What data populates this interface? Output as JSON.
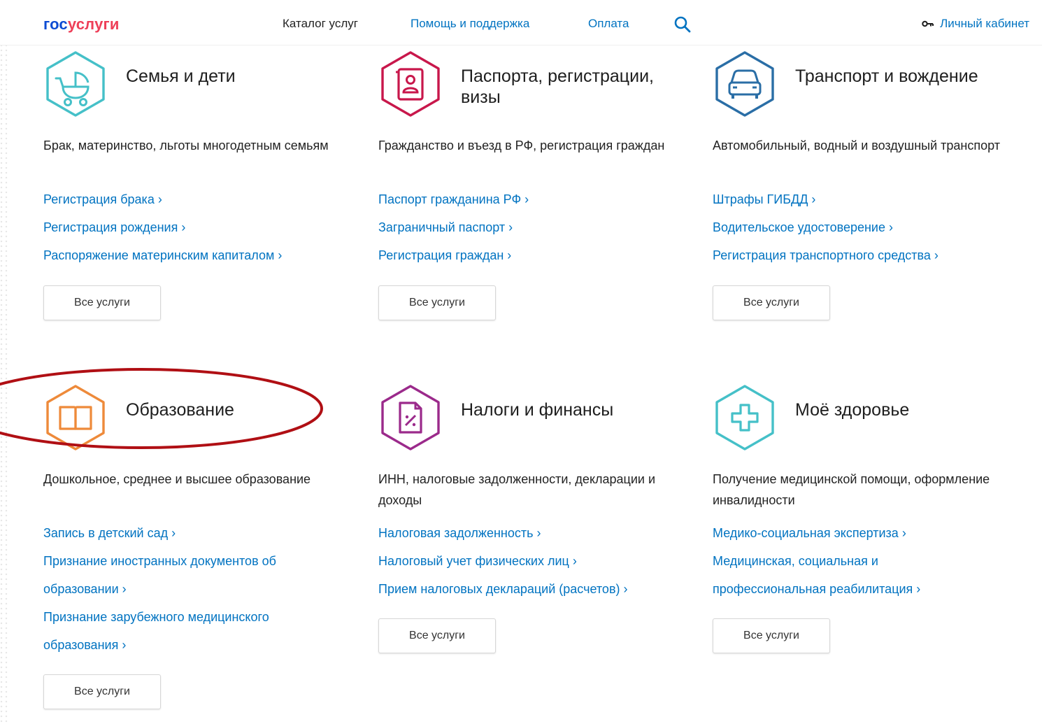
{
  "header": {
    "logo_part1": "гос",
    "logo_part2": "услуги",
    "nav": [
      "Каталог услуг",
      "Помощь и поддержка",
      "Оплата"
    ],
    "search_icon": "search-icon",
    "account_label": "Личный кабинет",
    "account_icon": "key-icon"
  },
  "colors": {
    "link": "#0173c1",
    "family": "#45c0c8",
    "passport": "#c8174b",
    "transport": "#2a6ea6",
    "education": "#ee8a3a",
    "taxes": "#9b2a8b",
    "health": "#45c0c8",
    "annotation": "#b00f14"
  },
  "categories": [
    {
      "title": "Семья и дети",
      "icon": "stroller-icon",
      "description": "Брак, материнство, льготы многодетным семьям",
      "links": [
        "Регистрация брака ›",
        "Регистрация рождения ›",
        "Распоряжение материнским капиталом ›"
      ],
      "button": "Все услуги"
    },
    {
      "title": "Паспорта, регистрации, визы",
      "icon": "passport-icon",
      "description": "Гражданство и въезд в РФ, регистрация граждан",
      "links": [
        "Паспорт гражданина РФ ›",
        "Заграничный паспорт ›",
        "Регистрация граждан ›"
      ],
      "button": "Все услуги"
    },
    {
      "title": "Транспорт и вождение",
      "icon": "car-icon",
      "description": "Автомобильный, водный и воздушный транспорт",
      "links": [
        "Штрафы ГИБДД ›",
        "Водительское удостоверение ›",
        "Регистрация транспортного средства ›"
      ],
      "button": "Все услуги"
    },
    {
      "title": "Образование",
      "icon": "book-icon",
      "description": "Дошкольное, среднее и высшее образование",
      "links": [
        "Запись в детский сад ›",
        "Признание иностранных документов об образовании ›",
        "Признание зарубежного медицинского образования ›"
      ],
      "button": "Все услуги"
    },
    {
      "title": "Налоги и финансы",
      "icon": "tax-document-icon",
      "description": "ИНН, налоговые задолженности, декларации и доходы",
      "links": [
        "Налоговая задолженность ›",
        "Налоговый учет физических лиц ›",
        "Прием налоговых деклараций (расчетов) ›"
      ],
      "button": "Все услуги"
    },
    {
      "title": "Моё здоровье",
      "icon": "medical-cross-icon",
      "description": "Получение медицинской помощи, оформление инвалидности",
      "links": [
        "Медико-социальная экспертиза ›",
        "Медицинская, социальная и профессиональная реабилитация ›"
      ],
      "button": "Все услуги"
    }
  ]
}
